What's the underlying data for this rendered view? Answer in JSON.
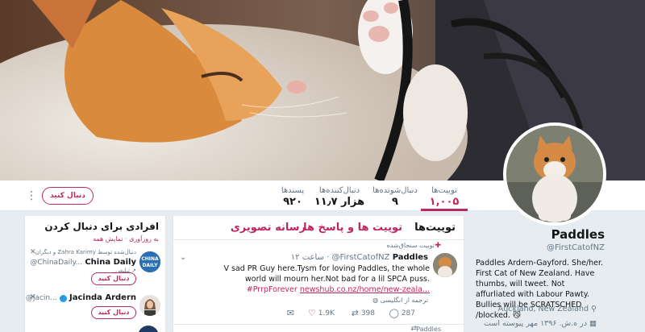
{
  "profile_nav": {
    "stats": [
      {
        "label": "توییت‌ها",
        "value": "۱,۰۰۵",
        "active": true
      },
      {
        "label": "دنبال‌شونده‌ها",
        "value": "۹"
      },
      {
        "label": "دنبال‌کننده‌ها",
        "value": "۱۱٫۷ هزار"
      },
      {
        "label": "پسندها",
        "value": "۹۲۰"
      }
    ],
    "follow_label": "دنبال کنید",
    "more_icon": "more-vertical-icon"
  },
  "profile": {
    "name": "Paddles",
    "handle": "@FirstCatofNZ",
    "bio": "Paddles Ardern-Gayford. She/her. First Cat of New Zealand. Have thumbs, will tweet. Not affurliated with Labour Pawty. Bullies will be SCRATSCHED /blocked.",
    "bio_emoji": "😼",
    "location": "Auckland, New Zealand",
    "joined": "در ه.ش. ۱۳۹۶ مهر پیوسته است",
    "location_icon": "map-pin-icon",
    "calendar_icon": "calendar-icon"
  },
  "timeline": {
    "tabs": [
      {
        "label": "توییت‌ها",
        "active": true
      },
      {
        "label": "توییت ها و پاسخ ها"
      },
      {
        "label": "رسانه تصویری"
      }
    ],
    "pinned_label": "توییت سنجاق‌شده",
    "tweet": {
      "name": "Paddles",
      "handle": "@FirstCatofNZ",
      "time": "۱۲ ساعت",
      "text": "V sad PR Guy here.Tysm for loving Paddles, the whole world will mourn her.Not bad for a lil SPCA puss.",
      "hashtag": "#PrrpForever",
      "link": "newshub.co.nz/home/new-zeala...",
      "translate": "ترجمه از انگلیسی",
      "replies": "287",
      "retweets": "398",
      "likes": "1.9K"
    },
    "next_peek": "Paddles"
  },
  "who_to_follow": {
    "title": "افرادی برای دنبال کردن",
    "refresh": "به روزآوری",
    "view_all": "نمایش همه",
    "items": [
      {
        "via": "دنبال‌شده توسط Zahra Karimy و دیگران",
        "name": "China Daily",
        "handle": "@ChinaDaily...",
        "follow_label": "دنبال کنید",
        "promoted": "تبلیغی"
      },
      {
        "name": "Jacinda Ardern",
        "handle": "@jacin...",
        "follow_label": "دنبال کنید"
      }
    ]
  },
  "colors": {
    "accent": "#c0265f",
    "verified": "#1da1f2"
  }
}
